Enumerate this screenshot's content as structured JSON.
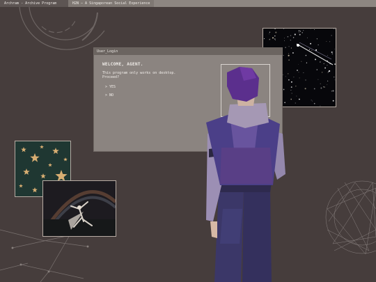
{
  "tabs": [
    {
      "label": "Archram - Archive Program",
      "active": true
    },
    {
      "label": "H2N — A Singaporean Social Experience",
      "active": false
    }
  ],
  "dialog": {
    "title": "User_Login",
    "heading": "WELCOME, AGENT.",
    "message": "This program only works on desktop. Proceed?",
    "options": [
      "> YES",
      "> NO"
    ]
  },
  "images": [
    {
      "name": "starry-sky-image",
      "subject": "shooting star over starry sky"
    },
    {
      "name": "star-pattern-image",
      "subject": "gold stars on dark green"
    },
    {
      "name": "rainbow-dancer-image",
      "subject": "figure under night rainbow"
    }
  ],
  "colors": {
    "background": "#463d3c",
    "dialog": "#8b8480",
    "agent_jacket": "#4b3f88",
    "agent_hair": "#5b2f8d"
  }
}
